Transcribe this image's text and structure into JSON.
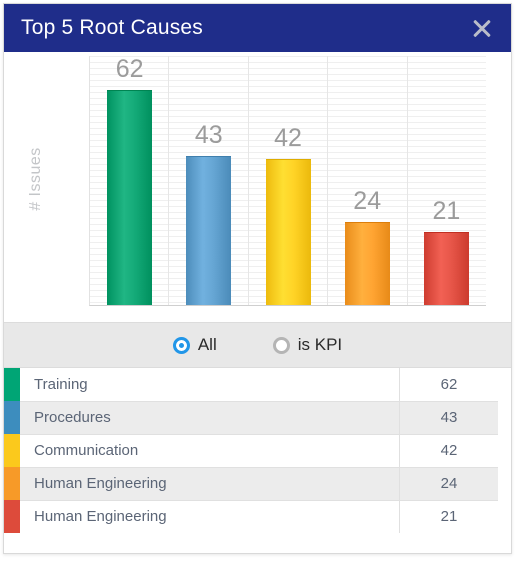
{
  "dialog": {
    "title": "Top 5 Root Causes",
    "close_icon": "close-icon"
  },
  "chart_data": {
    "type": "bar",
    "title": "Top 5 Root Causes",
    "xlabel": "",
    "ylabel": "# Issues",
    "ylim": [
      0,
      72
    ],
    "grid": true,
    "legend": "none",
    "categories": [
      "Training",
      "Procedures",
      "Communication",
      "Human Engineering",
      "Human Engineering"
    ],
    "values": [
      62,
      43,
      42,
      24,
      21
    ],
    "data_labels": [
      "62",
      "43",
      "42",
      "24",
      "21"
    ],
    "colors": [
      "#0aa06e",
      "#5b9bc9",
      "#fbc91c",
      "#f79a28",
      "#dc4b3e"
    ]
  },
  "filter": {
    "options": [
      {
        "label": "All",
        "selected": true,
        "icon": "radio-on-icon"
      },
      {
        "label": "is KPI",
        "selected": false,
        "icon": "radio-off-icon"
      }
    ]
  },
  "table": {
    "rows": [
      {
        "name": "Training",
        "value": "62",
        "color": "#00a575"
      },
      {
        "name": "Procedures",
        "value": "43",
        "color": "#3d8dbe"
      },
      {
        "name": "Communication",
        "value": "42",
        "color": "#fbc91c"
      },
      {
        "name": "Human Engineering",
        "value": "24",
        "color": "#f79a28"
      },
      {
        "name": "Human Engineering",
        "value": "21",
        "color": "#dd4b3b"
      }
    ]
  },
  "theme": {
    "titlebar_bg": "#1f2d8a",
    "filter_bg": "#e8e8e8",
    "row_alt_bg": "#ececec",
    "text_muted": "#5b6576",
    "accent": "#2196e8"
  }
}
